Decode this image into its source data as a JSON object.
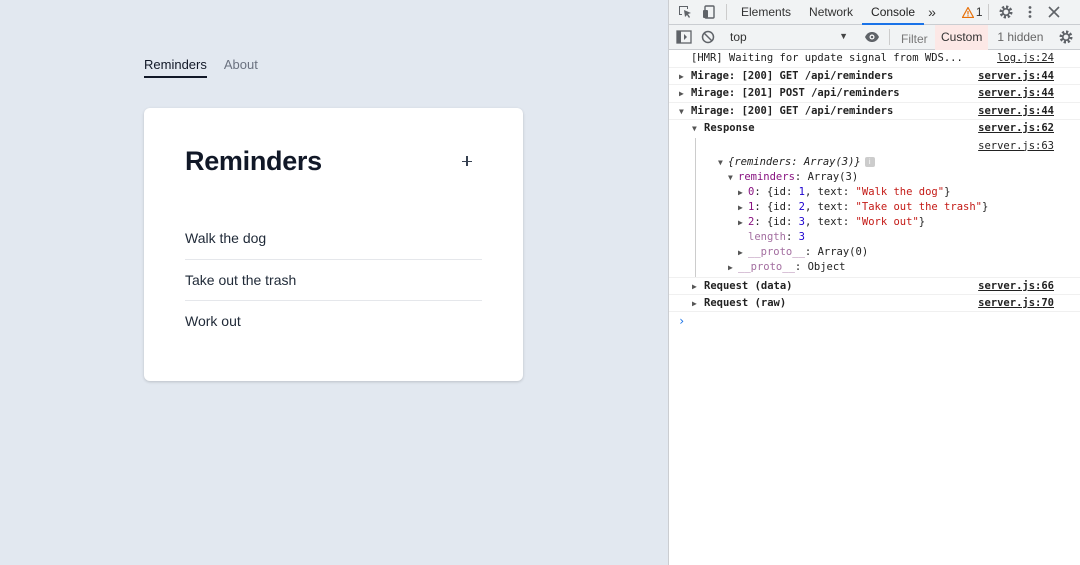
{
  "app": {
    "nav": [
      {
        "label": "Reminders",
        "active": true
      },
      {
        "label": "About",
        "active": false
      }
    ],
    "title": "Reminders",
    "reminders": [
      "Walk the dog",
      "Take out the trash",
      "Work out"
    ]
  },
  "devtools": {
    "tabs": [
      "Elements",
      "Network",
      "Console"
    ],
    "active_tab": "Console",
    "more_tabs": "»",
    "warning_count": "1",
    "context": "top",
    "filter_placeholder": "Filter",
    "levels": "Custom",
    "hidden": "1 hidden",
    "console": {
      "hmr": {
        "text": "[HMR] Waiting for update signal from WDS...",
        "src": "log.js:24"
      },
      "mirage1": {
        "text": "Mirage: [200] GET /api/reminders",
        "src": "server.js:44"
      },
      "mirage2": {
        "text": "Mirage: [201] POST /api/reminders",
        "src": "server.js:44"
      },
      "mirage3": {
        "text": "Mirage: [200] GET /api/reminders",
        "src": "server.js:44"
      },
      "response": {
        "label": "Response",
        "src": "server.js:62"
      },
      "response_src2": "server.js:63",
      "obj_preview": "{reminders: Array(3)}",
      "obj_key": "reminders",
      "obj_type": "Array(3)",
      "items": [
        {
          "index": "0",
          "id": "1",
          "text": "\"Walk the dog\""
        },
        {
          "index": "1",
          "id": "2",
          "text": "\"Take out the trash\""
        },
        {
          "index": "2",
          "id": "3",
          "text": "\"Work out\""
        }
      ],
      "length_key": "length",
      "length_val": "3",
      "proto_key": "__proto__",
      "proto_array": "Array(0)",
      "proto_object": "Object",
      "request_data": {
        "label": "Request (data)",
        "src": "server.js:66"
      },
      "request_raw": {
        "label": "Request (raw)",
        "src": "server.js:70"
      },
      "prompt": "›"
    }
  }
}
